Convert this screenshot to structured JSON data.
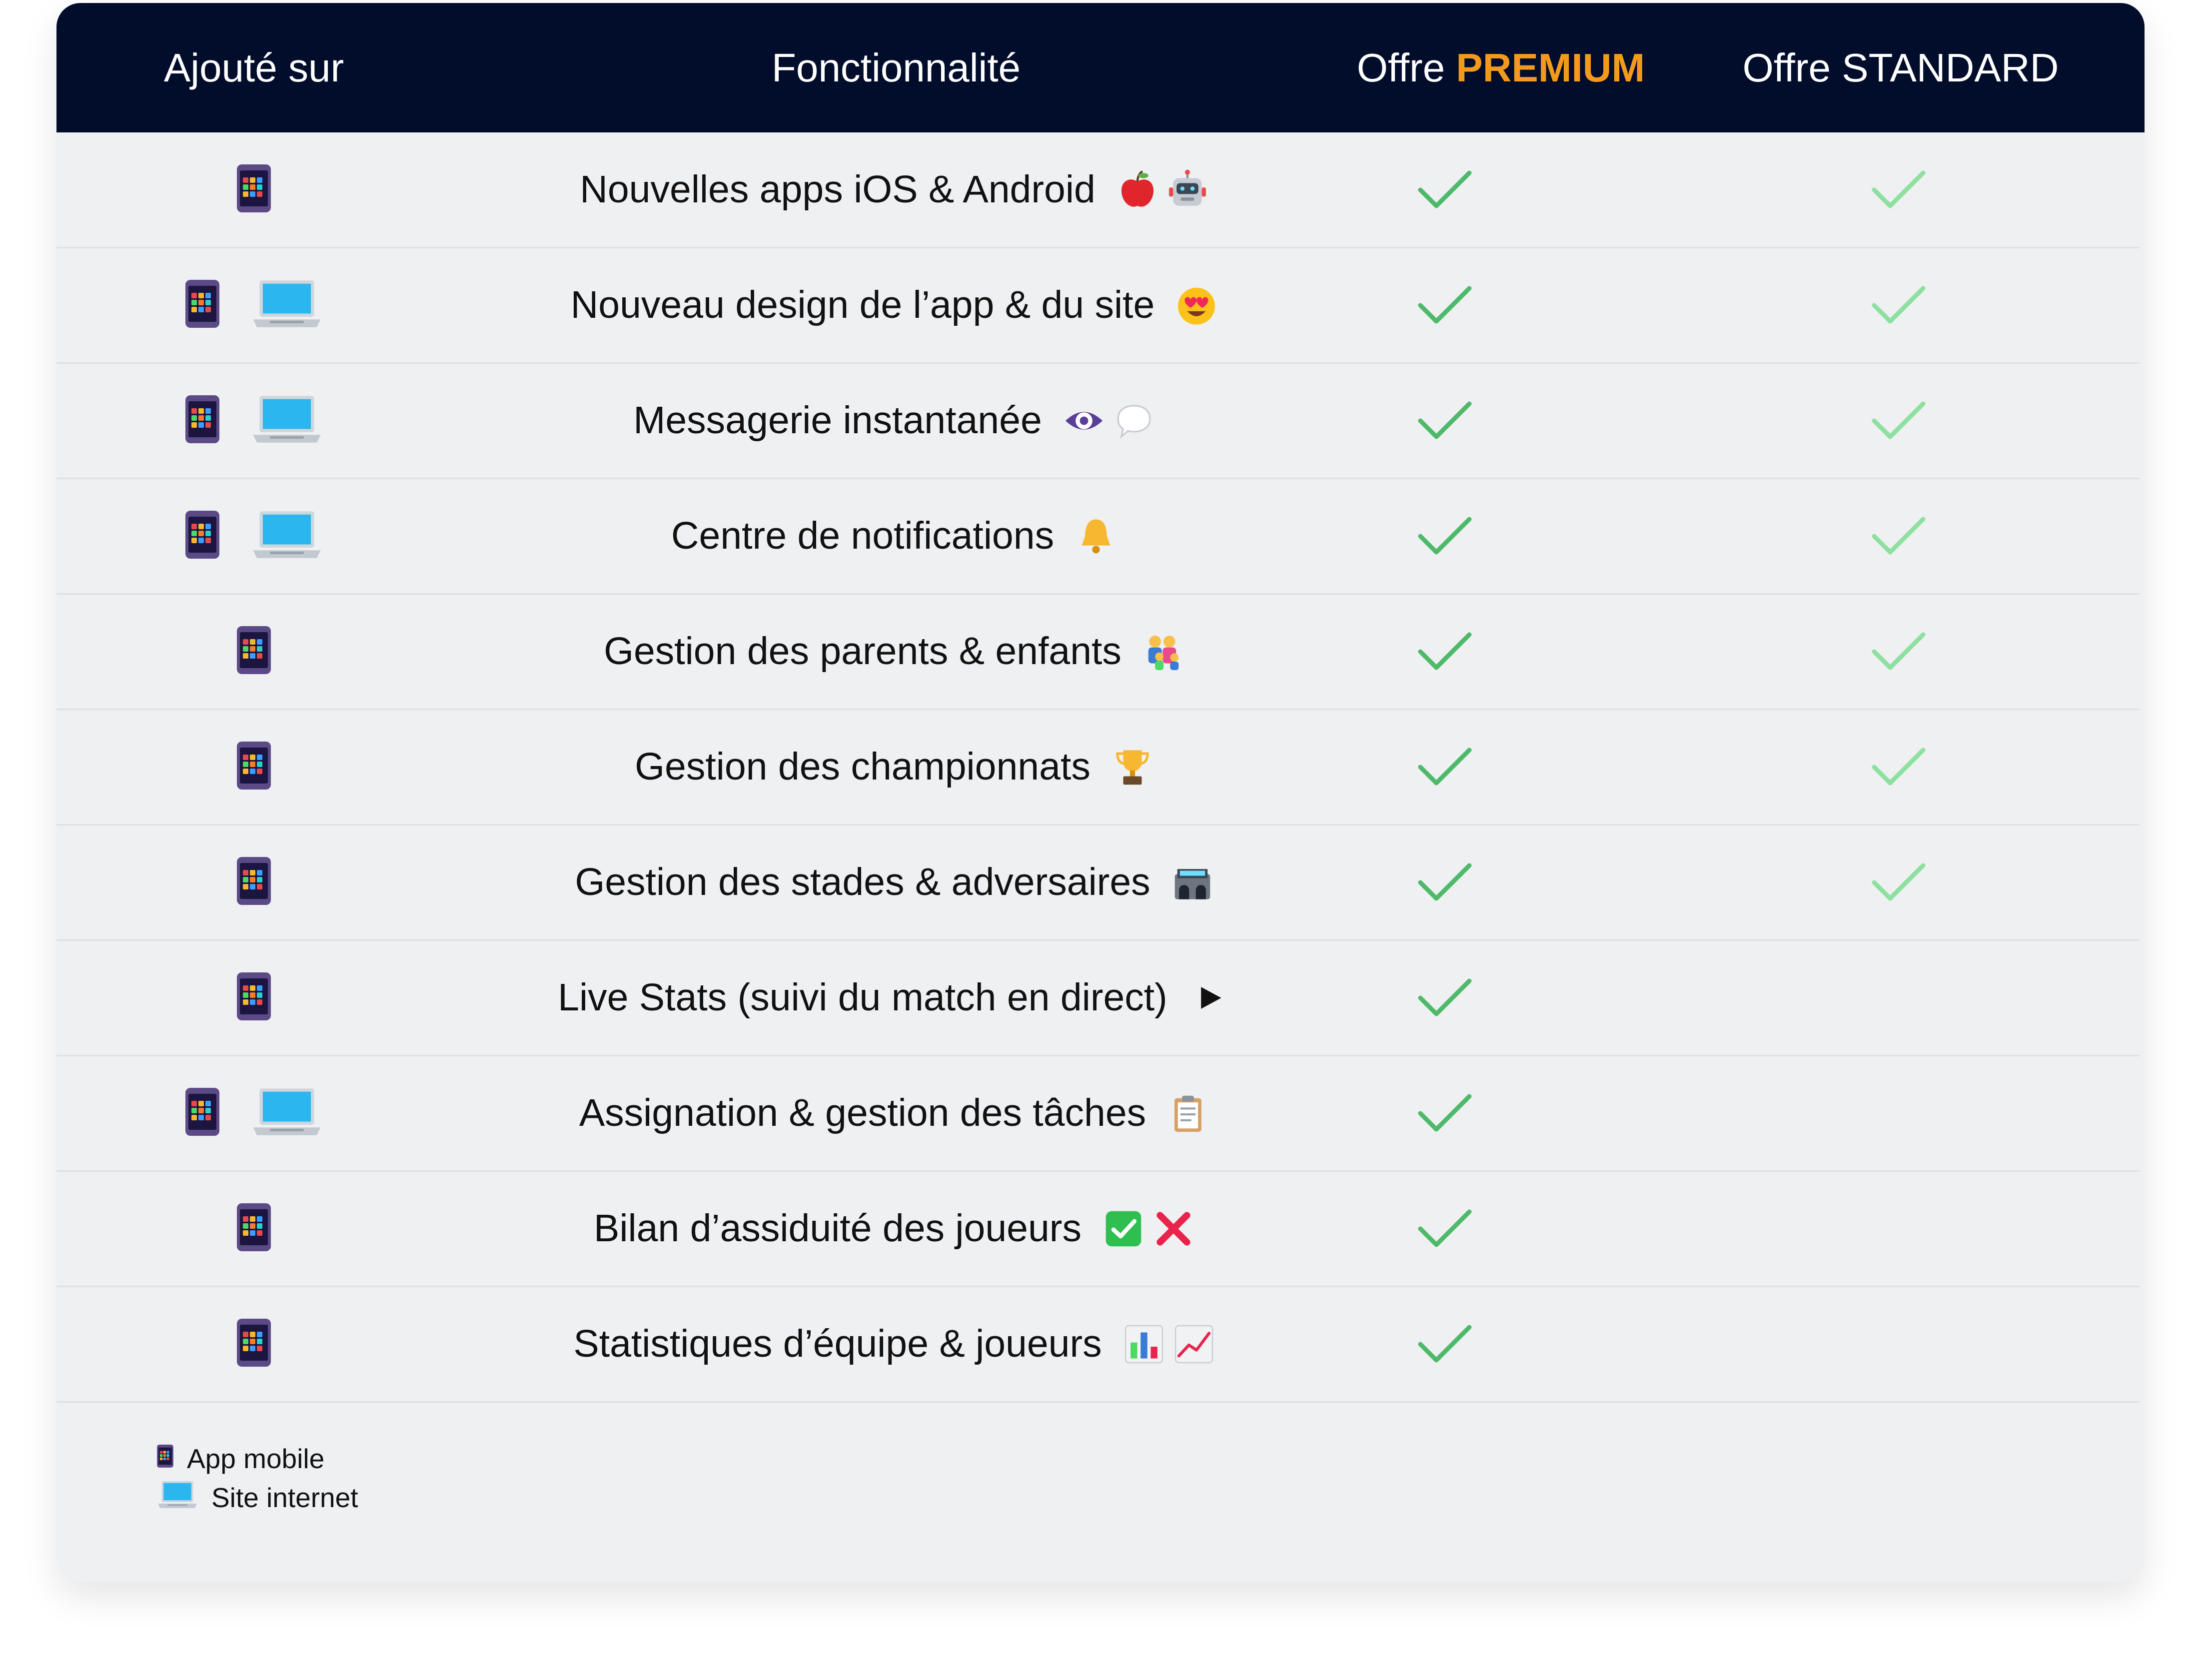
{
  "header": {
    "col_added": "Ajouté sur",
    "col_feature": "Fonctionnalité",
    "col_premium_prefix": "Offre ",
    "col_premium_highlight": "PREMIUM",
    "col_standard": "Offre STANDARD"
  },
  "colors": {
    "header_bg": "#020d2c",
    "premium_accent": "#f39a1c",
    "check_premium": "#4fb96a",
    "check_standard": "#8ee0a0",
    "card_bg": "#eef0f2"
  },
  "rows": [
    {
      "feature": "Nouvelles apps iOS & Android",
      "platforms": [
        "mobile"
      ],
      "emojis": [
        "apple-emoji",
        "robot-emoji"
      ],
      "premium": true,
      "standard": true
    },
    {
      "feature": "Nouveau design de l’app & du site",
      "platforms": [
        "mobile",
        "web"
      ],
      "emojis": [
        "heart-eyes-emoji"
      ],
      "premium": true,
      "standard": true
    },
    {
      "feature": "Messagerie instantanée",
      "platforms": [
        "mobile",
        "web"
      ],
      "emojis": [
        "eye-emoji",
        "speech-bubble-emoji"
      ],
      "premium": true,
      "standard": true
    },
    {
      "feature": "Centre de notifications",
      "platforms": [
        "mobile",
        "web"
      ],
      "emojis": [
        "bell-emoji"
      ],
      "premium": true,
      "standard": true
    },
    {
      "feature": "Gestion des parents & enfants",
      "platforms": [
        "mobile"
      ],
      "emojis": [
        "family-emoji"
      ],
      "premium": true,
      "standard": true
    },
    {
      "feature": "Gestion des championnats",
      "platforms": [
        "mobile"
      ],
      "emojis": [
        "trophy-emoji"
      ],
      "premium": true,
      "standard": true
    },
    {
      "feature": "Gestion des stades & adversaires",
      "platforms": [
        "mobile"
      ],
      "emojis": [
        "stadium-emoji"
      ],
      "premium": true,
      "standard": true
    },
    {
      "feature": "Live Stats (suivi du match en direct)",
      "platforms": [
        "mobile"
      ],
      "emojis": [
        "play-emoji"
      ],
      "premium": true,
      "standard": false
    },
    {
      "feature": "Assignation & gestion des tâches",
      "platforms": [
        "mobile",
        "web"
      ],
      "emojis": [
        "clipboard-emoji"
      ],
      "premium": true,
      "standard": false
    },
    {
      "feature": "Bilan d’assiduité des joueurs",
      "platforms": [
        "mobile"
      ],
      "emojis": [
        "check-box-emoji",
        "cross-mark-emoji"
      ],
      "premium": true,
      "standard": false
    },
    {
      "feature": "Statistiques d’équipe & joueurs",
      "platforms": [
        "mobile"
      ],
      "emojis": [
        "bar-chart-emoji",
        "trend-chart-emoji"
      ],
      "premium": true,
      "standard": false
    }
  ],
  "legend": {
    "mobile_label": "App mobile",
    "web_label": "Site internet"
  }
}
